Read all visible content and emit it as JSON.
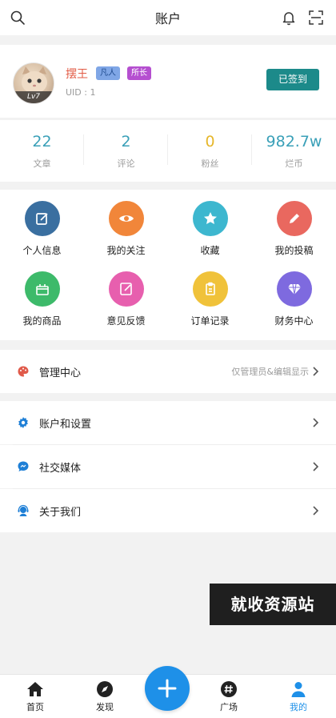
{
  "header": {
    "title": "账户",
    "left_icon": "search-icon",
    "right_icons": [
      "bell-icon",
      "scan-icon"
    ]
  },
  "profile": {
    "name": "摆王",
    "badges": [
      {
        "label": "凡人",
        "bg": "#7fa6e6",
        "color": "#1f4b8f"
      },
      {
        "label": "所长",
        "bg": "#b54fd0",
        "color": "#ffffff"
      }
    ],
    "level": "Lv7",
    "uid": "UID : 1",
    "checkin_label": "已签到",
    "checkin_color": "#1c8a8a",
    "name_color": "#e25b45"
  },
  "stats": [
    {
      "value": "22",
      "label": "文章",
      "color": "#3aa0b8"
    },
    {
      "value": "2",
      "label": "评论",
      "color": "#3aa0b8"
    },
    {
      "value": "0",
      "label": "粉丝",
      "color": "#e6b72c"
    },
    {
      "value": "982.7w",
      "label": "烂币",
      "color": "#3aa0b8"
    }
  ],
  "grid": [
    {
      "label": "个人信息",
      "color": "#3a6fa0",
      "icon": "edit-square-icon"
    },
    {
      "label": "我的关注",
      "color": "#f1863a",
      "icon": "eye-icon"
    },
    {
      "label": "收藏",
      "color": "#3db7cf",
      "icon": "star-icon"
    },
    {
      "label": "我的投稿",
      "color": "#e9685f",
      "icon": "pencil-icon"
    },
    {
      "label": "我的商品",
      "color": "#3dba6a",
      "icon": "gift-icon"
    },
    {
      "label": "意见反馈",
      "color": "#e75fae",
      "icon": "feedback-icon"
    },
    {
      "label": "订单记录",
      "color": "#f0c23a",
      "icon": "clipboard-icon"
    },
    {
      "label": "财务中心",
      "color": "#7e6adf",
      "icon": "diamond-icon"
    }
  ],
  "admin_row": {
    "label": "管理中心",
    "note": "仅管理员&编辑显示",
    "icon": "palette-icon",
    "icon_color": "#e05a4a"
  },
  "menu": [
    {
      "label": "账户和设置",
      "icon": "gear-icon",
      "icon_color": "#1e7fd6"
    },
    {
      "label": "社交媒体",
      "icon": "chat-icon",
      "icon_color": "#1e7fd6"
    },
    {
      "label": "关于我们",
      "icon": "support-icon",
      "icon_color": "#1e7fd6"
    }
  ],
  "watermark": "就收资源站",
  "tabs": [
    {
      "label": "首页",
      "icon": "home-icon",
      "active": false
    },
    {
      "label": "发现",
      "icon": "compass-icon",
      "active": false
    },
    {
      "label": "广场",
      "icon": "hashtag-icon",
      "active": false
    },
    {
      "label": "我的",
      "icon": "user-icon",
      "active": true
    }
  ],
  "accent_color": "#1e90e8"
}
